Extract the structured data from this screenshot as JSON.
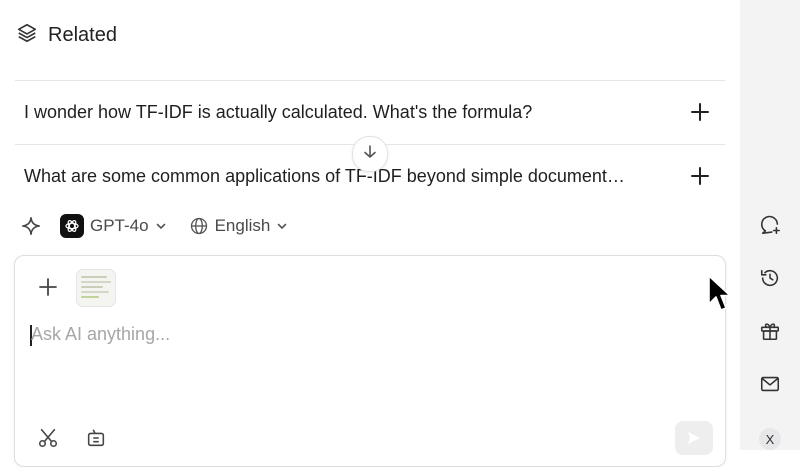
{
  "related": {
    "title": "Related",
    "icon": "layers-icon",
    "questions": [
      {
        "text": "I wonder how TF-IDF is actually calculated. What's the formula?",
        "icon": "plus-icon"
      },
      {
        "text": "What are some common applications of TF-IDF beyond simple document…",
        "icon": "plus-icon"
      }
    ]
  },
  "toolbar": {
    "model_label": "GPT-4o",
    "language_label": "English"
  },
  "composer": {
    "placeholder": "Ask AI anything...",
    "value": ""
  },
  "rightbar": {
    "icons": [
      "new-chat-icon",
      "history-icon",
      "gift-icon",
      "mail-icon"
    ],
    "close_label": "X"
  },
  "colors": {
    "text": "#1f1f1f",
    "muted": "#4a4a4a",
    "placeholder": "#a6a6a6",
    "sidebar_bg": "#f3f3f4",
    "divider": "#e6e6e6"
  }
}
